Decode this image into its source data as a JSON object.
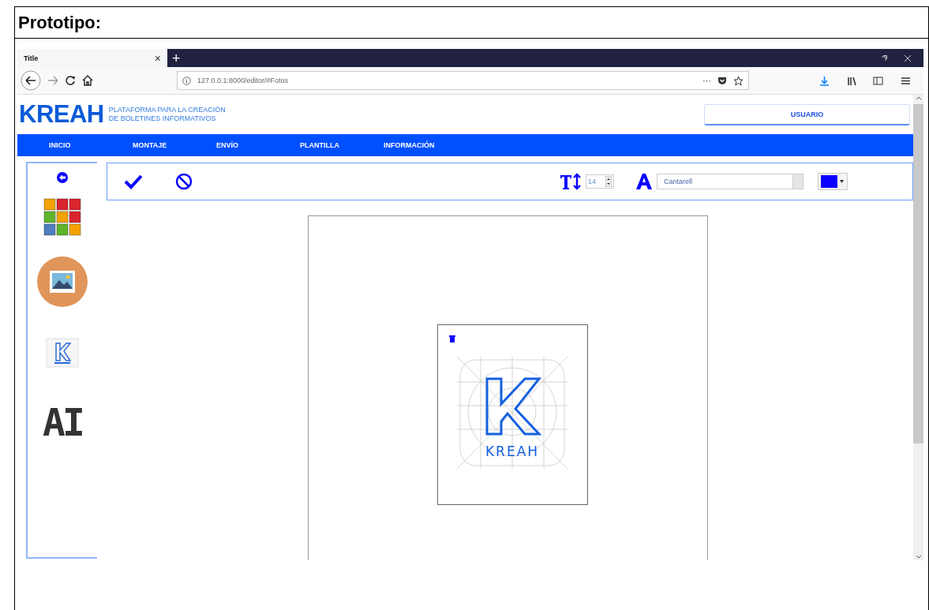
{
  "document": {
    "heading": "Prototipo:"
  },
  "browser": {
    "tab_title": "Title",
    "tab_close": "×",
    "new_tab": "+",
    "url": "127.0.0.1:8000/editor/#Fotos",
    "page_actions": "···"
  },
  "site": {
    "logo": "KREAH",
    "tagline": [
      "PLATAFORMA PARA LA CREACIÓN",
      "DE BOLETINES INFORMATIVOS"
    ],
    "user_button": "USUARIO",
    "nav": [
      {
        "label": "INICIO"
      },
      {
        "label": "MONTAJE"
      },
      {
        "label": "ENVÍO"
      },
      {
        "label": "PLANTILLA"
      },
      {
        "label": "INFORMACIÓN"
      }
    ]
  },
  "editor": {
    "toolbar": {
      "font_size": "14",
      "font_family": "Cantarell",
      "color": "#0a00ff"
    },
    "tools": [
      {
        "kind": "back"
      },
      {
        "kind": "palette"
      },
      {
        "kind": "image"
      },
      {
        "kind": "logo"
      },
      {
        "kind": "text",
        "label": "AI"
      }
    ],
    "canvas": {
      "logo_caption": "KREAH"
    }
  }
}
